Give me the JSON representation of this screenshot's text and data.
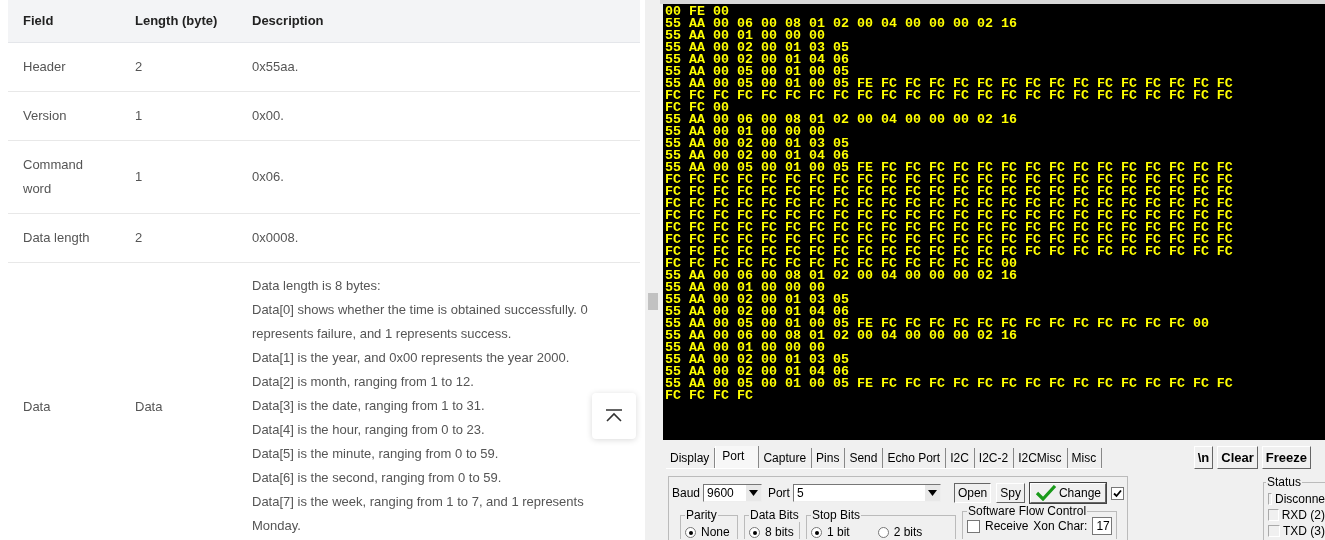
{
  "doc_table": {
    "columns": [
      "Field",
      "Length (byte)",
      "Description"
    ],
    "rows": [
      {
        "field": "Header",
        "length": "2",
        "description": [
          "0x55aa."
        ]
      },
      {
        "field": "Version",
        "length": "1",
        "description": [
          "0x00."
        ]
      },
      {
        "field": "Command word",
        "length": "1",
        "description": [
          "0x06."
        ]
      },
      {
        "field": "Data length",
        "length": "2",
        "description": [
          "0x0008."
        ]
      },
      {
        "field": "Data",
        "length": "Data",
        "description": [
          "Data length is 8 bytes:",
          "Data[0] shows whether the time is obtained successfully. 0 represents failure, and 1 represents success.",
          "Data[1] is the year, and 0x00 represents the year 2000.",
          "Data[2] is month, ranging from 1 to 12.",
          "Data[3] is the date, ranging from 1 to 31.",
          "Data[4] is the hour, ranging from 0 to 23.",
          "Data[5] is the minute, ranging from 0 to 59.",
          "Data[6] is the second, ranging from 0 to 59.",
          "Data[7] is the week, ranging from 1 to 7, and 1 represents Monday."
        ]
      }
    ]
  },
  "terminal": {
    "lines": [
      "00 FE 00",
      "55 AA 00 06 00 08 01 02 00 04 00 00 00 02 16",
      "55 AA 00 01 00 00 00",
      "55 AA 00 02 00 01 03 05",
      "55 AA 00 02 00 01 04 06",
      "55 AA 00 05 00 01 00 05",
      "55 AA 00 05 00 01 00 05 FE FC FC FC FC FC FC FC FC FC FC FC FC FC FC FC",
      "FC FC FC FC FC FC FC FC FC FC FC FC FC FC FC FC FC FC FC FC FC FC FC FC",
      "FC FC 00",
      "55 AA 00 06 00 08 01 02 00 04 00 00 00 02 16",
      "55 AA 00 01 00 00 00",
      "55 AA 00 02 00 01 03 05",
      "55 AA 00 02 00 01 04 06",
      "55 AA 00 05 00 01 00 05 FE FC FC FC FC FC FC FC FC FC FC FC FC FC FC FC",
      "FC FC FC FC FC FC FC FC FC FC FC FC FC FC FC FC FC FC FC FC FC FC FC FC",
      "FC FC FC FC FC FC FC FC FC FC FC FC FC FC FC FC FC FC FC FC FC FC FC FC",
      "FC FC FC FC FC FC FC FC FC FC FC FC FC FC FC FC FC FC FC FC FC FC FC FC",
      "FC FC FC FC FC FC FC FC FC FC FC FC FC FC FC FC FC FC FC FC FC FC FC FC",
      "FC FC FC FC FC FC FC FC FC FC FC FC FC FC FC FC FC FC FC FC FC FC FC FC",
      "FC FC FC FC FC FC FC FC FC FC FC FC FC FC FC FC FC FC FC FC FC FC FC FC",
      "FC FC FC FC FC FC FC FC FC FC FC FC FC FC FC FC FC FC FC FC FC FC FC FC",
      "FC FC FC FC FC FC FC FC FC FC FC FC FC FC 00",
      "55 AA 00 06 00 08 01 02 00 04 00 00 00 02 16",
      "55 AA 00 01 00 00 00",
      "55 AA 00 02 00 01 03 05",
      "55 AA 00 02 00 01 04 06",
      "55 AA 00 05 00 01 00 05 FE FC FC FC FC FC FC FC FC FC FC FC FC FC 00",
      "55 AA 00 06 00 08 01 02 00 04 00 00 00 02 16",
      "55 AA 00 01 00 00 00",
      "55 AA 00 02 00 01 03 05",
      "55 AA 00 02 00 01 04 06",
      "55 AA 00 05 00 01 00 05 FE FC FC FC FC FC FC FC FC FC FC FC FC FC FC FC",
      "FC FC FC FC"
    ]
  },
  "tabs": [
    {
      "label": "Display",
      "selected": false
    },
    {
      "label": "Port",
      "selected": true
    },
    {
      "label": "Capture",
      "selected": false
    },
    {
      "label": "Pins",
      "selected": false
    },
    {
      "label": "Send",
      "selected": false
    },
    {
      "label": "Echo Port",
      "selected": false
    },
    {
      "label": "I2C",
      "selected": false
    },
    {
      "label": "I2C-2",
      "selected": false
    },
    {
      "label": "I2CMisc",
      "selected": false
    },
    {
      "label": "Misc",
      "selected": false
    }
  ],
  "toolbar_buttons": [
    "\\n",
    "Clear",
    "Freeze"
  ],
  "port_settings": {
    "baud_label": "Baud",
    "baud": "9600",
    "port_label": "Port",
    "port": "5",
    "open_button": "Open",
    "spy_button": "Spy",
    "change_button": "Change",
    "change_enabled": {
      "checked": true
    },
    "groups": [
      {
        "title": "Parity",
        "options": [
          {
            "label": "None",
            "selected": true
          }
        ]
      },
      {
        "title": "Data Bits",
        "options": [
          {
            "label": "8 bits",
            "selected": true
          }
        ]
      },
      {
        "title": "Stop Bits",
        "options": [
          {
            "label": "1 bit",
            "selected": true
          },
          {
            "label": "2 bits",
            "selected": false
          }
        ]
      }
    ],
    "flow_control": {
      "title": "Software Flow Control",
      "receive_label": "Receive",
      "receive_checked": false,
      "xon_label": "Xon Char:",
      "xon": "17"
    }
  },
  "status": {
    "title": "Status",
    "items": [
      "Disconne",
      "RXD (2)",
      "TXD (3)"
    ]
  }
}
